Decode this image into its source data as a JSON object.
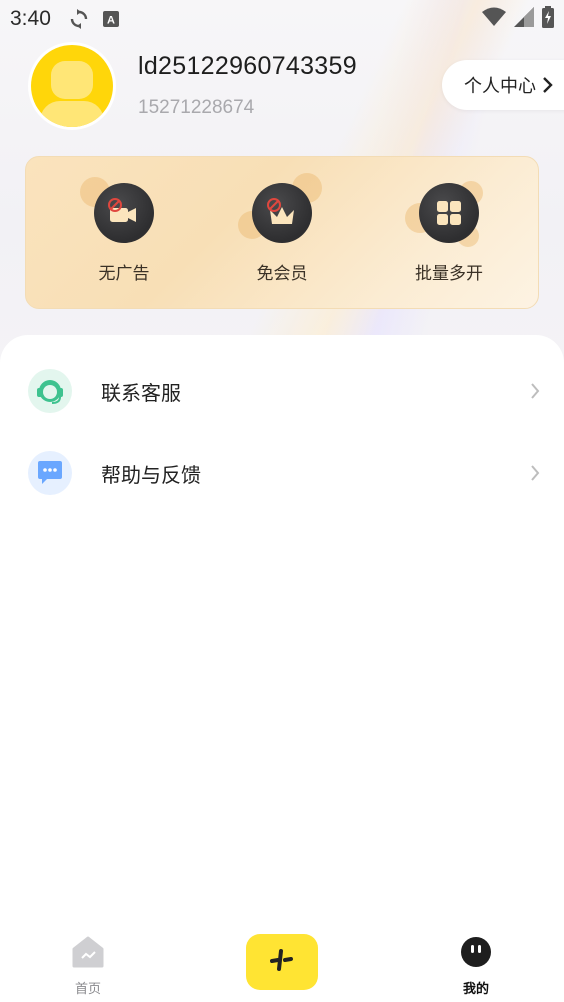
{
  "status_bar": {
    "time": "3:40",
    "icons": [
      "sync-icon",
      "text-a-icon",
      "wifi-icon",
      "signal-icon",
      "battery-charging-icon"
    ]
  },
  "profile": {
    "user_id": "ld25122960743359",
    "phone": "15271228674",
    "center_button_label": "个人中心",
    "avatar_color": "#ffd60a"
  },
  "vip_card": {
    "items": [
      {
        "label": "无广告",
        "icon": "no-ads-camera-icon"
      },
      {
        "label": "免会员",
        "icon": "no-vip-crown-icon"
      },
      {
        "label": "批量多开",
        "icon": "grid-apps-icon"
      }
    ],
    "background": "#f8dfb6"
  },
  "menu": {
    "items": [
      {
        "label": "联系客服",
        "icon": "customer-service-icon",
        "icon_color": "#3ec28f"
      },
      {
        "label": "帮助与反馈",
        "icon": "feedback-chat-icon",
        "icon_color": "#6aa7ff"
      }
    ]
  },
  "bottom_nav": {
    "items": [
      {
        "label": "首页",
        "icon": "home-icon",
        "active": false
      },
      {
        "label": "",
        "icon": "create-plus-icon",
        "active": false
      },
      {
        "label": "我的",
        "icon": "mine-face-icon",
        "active": true
      }
    ],
    "accent": "#ffe433"
  }
}
